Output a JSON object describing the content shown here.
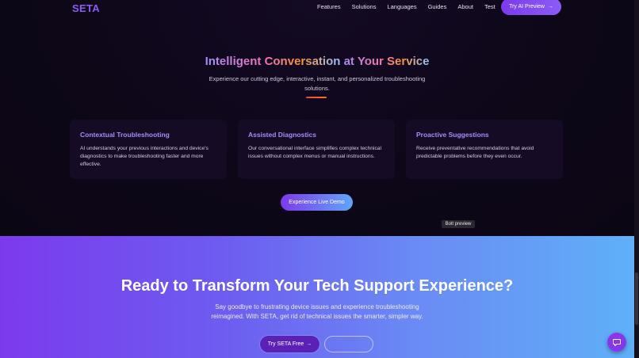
{
  "nav": {
    "logo": "SETA",
    "links": [
      "Features",
      "Solutions",
      "Languages",
      "Guides",
      "About",
      "Test"
    ],
    "cta_label": "Try AI Preview",
    "cta_icon": "arrow-right-icon"
  },
  "hero": {
    "title_part1": "Intelligent Conversation",
    "title_part2": " at Your Service",
    "subtitle": "Experience our cutting edge, interactive, instant, and personalized troubleshooting solutions."
  },
  "features": [
    {
      "title": "Contextual Troubleshooting",
      "description": "AI understands your previous interactions and device's diagnostics to make troubleshooting faster and more effective."
    },
    {
      "title": "Assisted Diagnostics",
      "description": "Our conversational interface simplifies complex technical issues without complex menus or manual instructions."
    },
    {
      "title": "Proactive Suggestions",
      "description": "Receive preventative recommendations that avoid predictable problems before they even occur."
    }
  ],
  "demo_button": "Experience Live Demo",
  "bolt_badge": "Bolt preview",
  "cta": {
    "title": "Ready to Transform Your Tech Support Experience?",
    "subtitle": "Say goodbye to frustrating device issues and experience troubleshooting reimagined. With SETA, get rid of technical issues the smarter, simpler way.",
    "primary_label": "Try SETA Free",
    "primary_icon": "arrow-right-icon",
    "secondary_label": ""
  },
  "colors": {
    "brand": "#8b5cf6",
    "background": "#0c0716",
    "card": "#150b25",
    "accent_rule": "#ef4444",
    "cta_gradient_start": "#7c3aed",
    "cta_gradient_end": "#5fb0f8"
  },
  "chat_fab_icon": "chat-bubble-icon"
}
